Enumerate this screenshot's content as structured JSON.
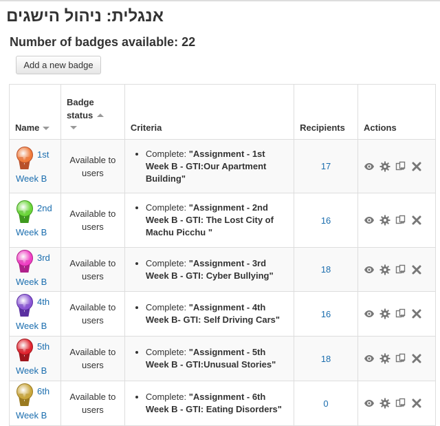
{
  "header": {
    "title": "אנגלית: ניהול הישגים",
    "count_text": "Number of badges available: 22",
    "add_button": "Add a new badge"
  },
  "table": {
    "columns": {
      "name": "Name",
      "status_line1": "Badge",
      "status_line2": "status",
      "criteria": "Criteria",
      "recipients": "Recipients",
      "actions": "Actions"
    },
    "rows": [
      {
        "name_part1": "1st",
        "name_part2": "Week B",
        "badge_color": "#f07a3a",
        "ribbon_color": "#b8502a",
        "status_line1": "Available to",
        "status_line2": "users",
        "criteria_prefix": "Complete:",
        "criteria_text": "\"Assignment - 1st Week B - GTI:Our Apartment Building\"",
        "recipients": "17"
      },
      {
        "name_part1": "2nd",
        "name_part2": "Week B",
        "badge_color": "#6cd63a",
        "ribbon_color": "#3f9a1e",
        "status_line1": "Available to",
        "status_line2": "users",
        "criteria_prefix": "Complete:",
        "criteria_text": "\"Assignment - 2nd Week B - GTI: The Lost City of Machu Picchu \"",
        "recipients": "16"
      },
      {
        "name_part1": "3rd",
        "name_part2": "Week B",
        "badge_color": "#f03fc4",
        "ribbon_color": "#b0208a",
        "status_line1": "Available to",
        "status_line2": "users",
        "criteria_prefix": "Complete:",
        "criteria_text": "\"Assignment - 3rd Week B - GTI: Cyber Bullying\"",
        "recipients": "18"
      },
      {
        "name_part1": "4th",
        "name_part2": "Week B",
        "badge_color": "#8a55d4",
        "ribbon_color": "#5a30a0",
        "status_line1": "Available to",
        "status_line2": "users",
        "criteria_prefix": "Complete:",
        "criteria_text": "\"Assignment - 4th Week B- GTI: Self Driving Cars\"",
        "recipients": "16"
      },
      {
        "name_part1": "5th",
        "name_part2": "Week B",
        "badge_color": "#e0242e",
        "ribbon_color": "#a0151c",
        "status_line1": "Available to",
        "status_line2": "users",
        "criteria_prefix": "Complete:",
        "criteria_text": "\"Assignment - 5th Week B - GTI:Unusual Stories\"",
        "recipients": "18"
      },
      {
        "name_part1": "6th",
        "name_part2": "Week B",
        "badge_color": "#c9a63c",
        "ribbon_color": "#9a7a20",
        "status_line1": "Available to",
        "status_line2": "users",
        "criteria_prefix": "Complete:",
        "criteria_text": "\"Assignment - 6th Week B - GTI: Eating Disorders\"",
        "recipients": "0"
      }
    ]
  },
  "action_icons": [
    "eye-icon",
    "gear-icon",
    "copy-icon",
    "delete-icon"
  ],
  "colors": {
    "link": "#1a6dae",
    "icon": "#777777"
  }
}
